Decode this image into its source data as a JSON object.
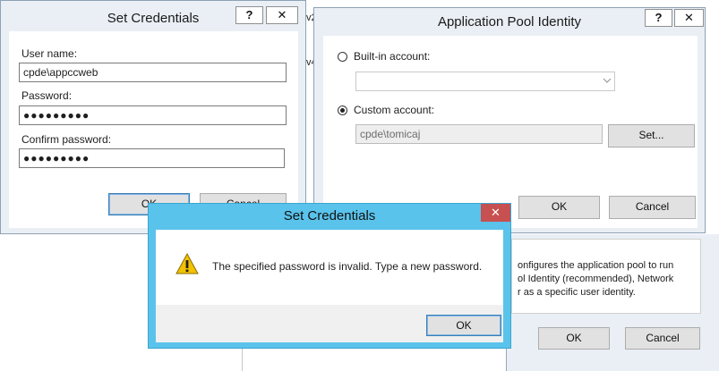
{
  "set_credentials": {
    "title": "Set Credentials",
    "help_label": "?",
    "close_label": "✕",
    "username_label": "User name:",
    "username_value": "cpde\\appccweb",
    "password_label": "Password:",
    "password_value": "●●●●●●●●●",
    "confirm_label": "Confirm password:",
    "confirm_value": "●●●●●●●●●",
    "ok_label": "OK",
    "cancel_label": "Cancel"
  },
  "app_pool_identity": {
    "title": "Application Pool Identity",
    "help_label": "?",
    "close_label": "✕",
    "builtin_label": "Built-in account:",
    "builtin_value": "",
    "custom_label": "Custom account:",
    "custom_value": "cpde\\tomicaj",
    "set_label": "Set...",
    "ok_label": "OK",
    "cancel_label": "Cancel"
  },
  "background": {
    "description_lines": [
      "onfigures the application pool to run",
      "ol Identity (recommended), Network",
      "r as a specific user identity."
    ],
    "ok_label": "OK",
    "cancel_label": "Cancel",
    "partial_text_1": "v2",
    "partial_text_2": "v4"
  },
  "error_dialog": {
    "title": "Set Credentials",
    "close_label": "✕",
    "message": "The specified password is invalid. Type a new password.",
    "ok_label": "OK"
  },
  "colors": {
    "inactive_chrome": "#eaeff5",
    "active_chrome": "#5ac3eb",
    "close_red": "#c75050"
  }
}
